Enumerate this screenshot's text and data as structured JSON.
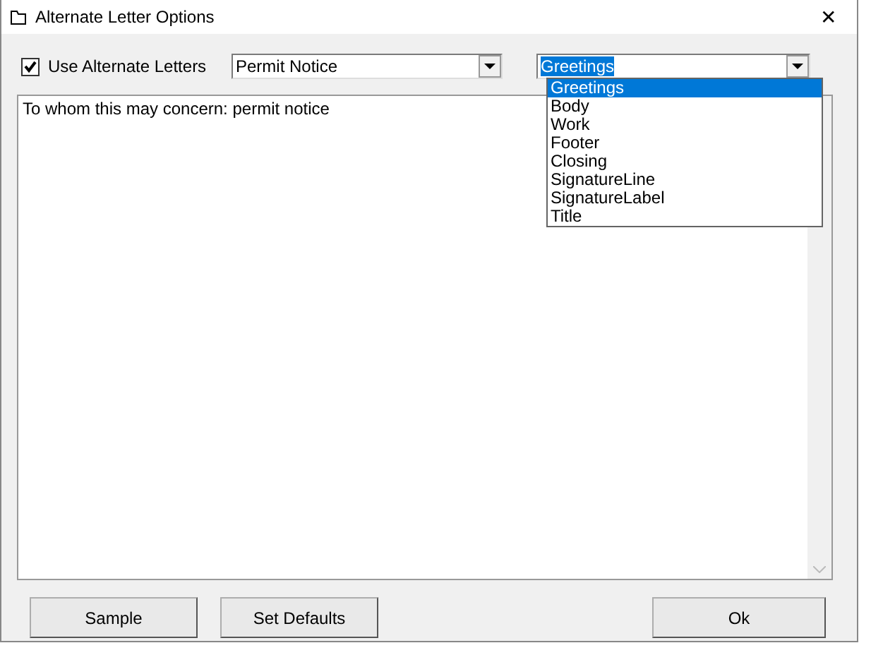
{
  "window": {
    "title": "Alternate Letter Options",
    "close": "✕"
  },
  "use_alternate": {
    "label": "Use Alternate Letters",
    "checked": true
  },
  "letter_combo": {
    "value": "Permit Notice"
  },
  "section_combo": {
    "value": "Greetings",
    "expanded": true,
    "options": [
      {
        "label": "Greetings",
        "selected": true
      },
      {
        "label": "Body",
        "selected": false
      },
      {
        "label": "Work",
        "selected": false
      },
      {
        "label": "Footer",
        "selected": false
      },
      {
        "label": "Closing",
        "selected": false
      },
      {
        "label": "SignatureLine",
        "selected": false
      },
      {
        "label": "SignatureLabel",
        "selected": false
      },
      {
        "label": "Title",
        "selected": false
      }
    ]
  },
  "text_area": {
    "value": "To whom this may concern: permit notice"
  },
  "buttons": [
    {
      "label": "Sample"
    },
    {
      "label": "Set Defaults"
    },
    {
      "label": "Ok"
    }
  ]
}
